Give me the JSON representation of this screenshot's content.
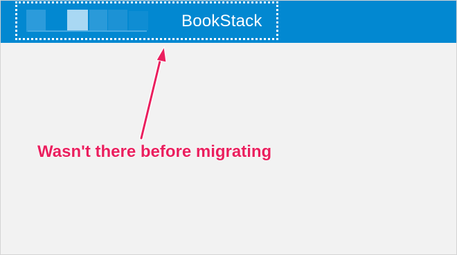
{
  "header": {
    "brand": "BookStack",
    "background_color": "#0288d1",
    "logo_icon": "blurred-logo-icon"
  },
  "annotation": {
    "text": "Wasn't there before migrating",
    "color": "#ea1f5e",
    "arrow_icon": "annotation-arrow-icon",
    "highlight": "dotted-highlight-box"
  },
  "page": {
    "background_color": "#f2f2f2"
  }
}
